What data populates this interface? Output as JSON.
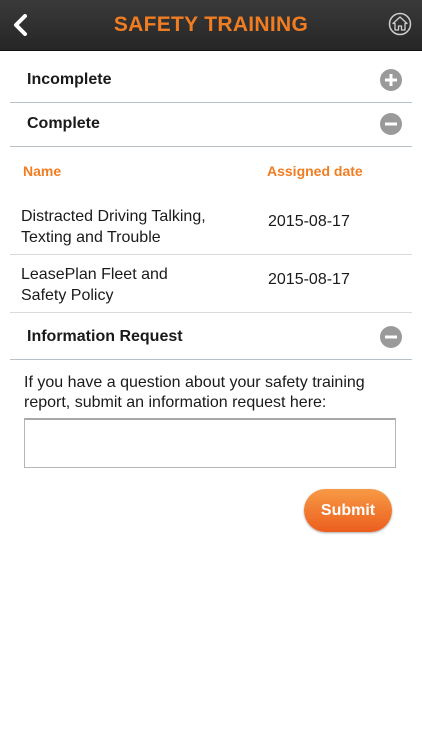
{
  "header": {
    "title": "SAFETY TRAINING",
    "back_icon": "chevron-left-icon",
    "home_icon": "home-icon",
    "title_color": "#f07d22"
  },
  "sections": {
    "incomplete": {
      "label": "Incomplete",
      "state": "collapsed",
      "icon": "plus-circle-icon"
    },
    "complete": {
      "label": "Complete",
      "state": "expanded",
      "icon": "minus-circle-icon"
    },
    "info_request": {
      "label": "Information Request",
      "state": "expanded",
      "icon": "minus-circle-icon"
    }
  },
  "complete_table": {
    "headers": {
      "name": "Name",
      "assigned_date": "Assigned date"
    },
    "rows": [
      {
        "name_line1": "Distracted Driving Talking,",
        "name_line2": "Texting and Trouble",
        "date": "2015-08-17"
      },
      {
        "name_line1": "LeasePlan Fleet and",
        "name_line2": "Safety Policy",
        "date": "2015-08-17"
      }
    ]
  },
  "info_request": {
    "prompt_line1": "If you have a question about your safety training",
    "prompt_line2": "report, submit an information request here:",
    "input_value": "",
    "submit_label": "Submit"
  },
  "colors": {
    "accent": "#f07d22",
    "header_bg": "#2e2e2e",
    "toggle_icon": "#9a9a9a"
  }
}
